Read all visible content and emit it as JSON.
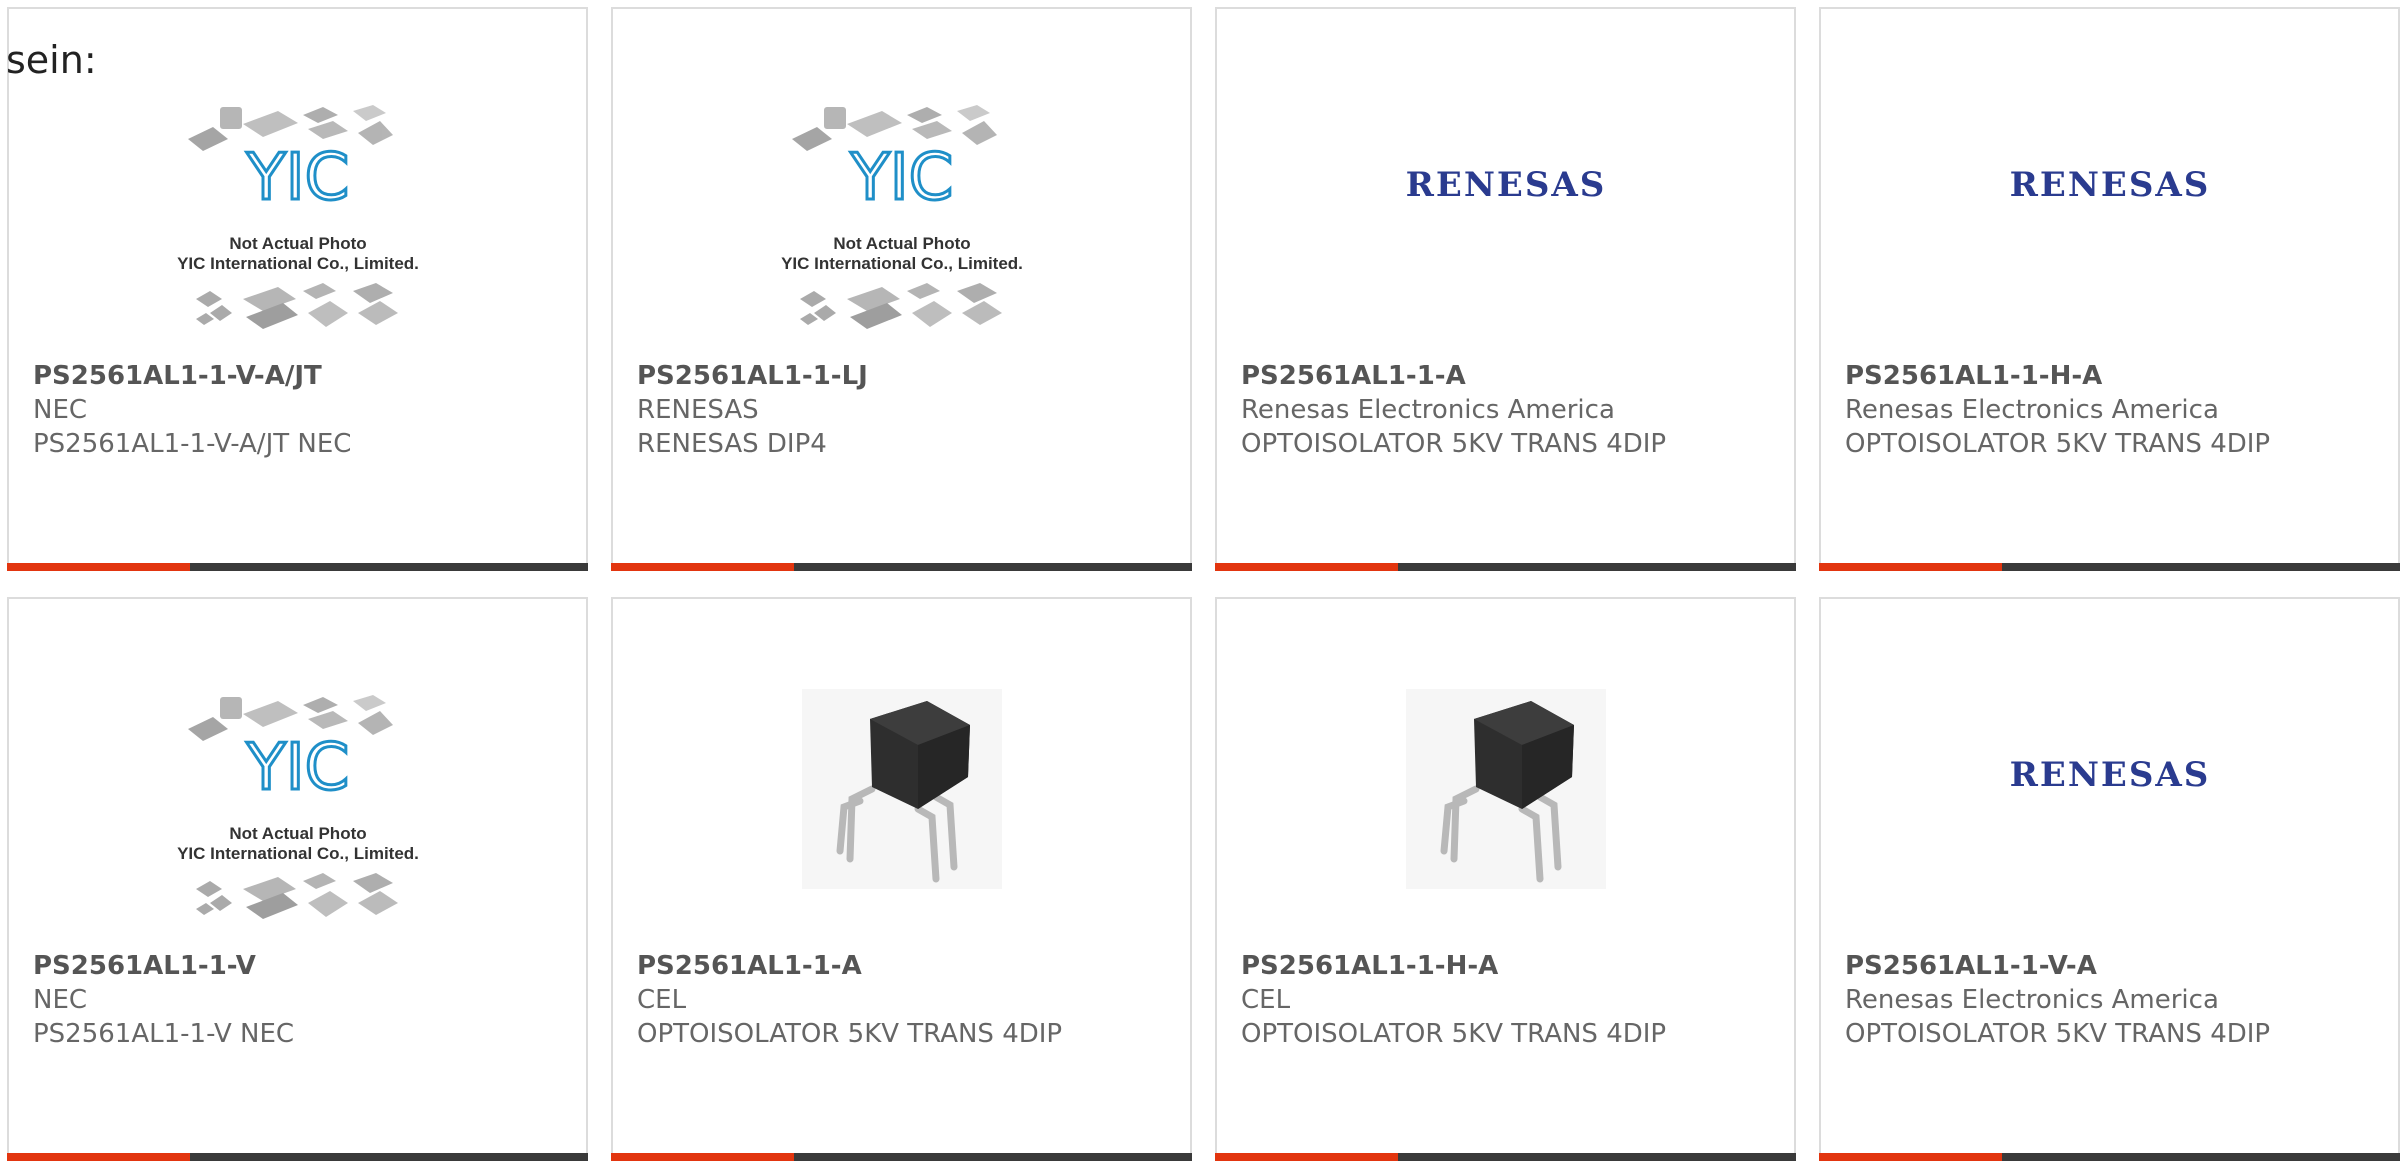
{
  "intro_text": "sein:",
  "placeholder_text": {
    "line1": "Not Actual Photo",
    "line2": "YIC International Co., Limited.",
    "logo": "YIC"
  },
  "renesas_logo_text": "RENESAS",
  "colors": {
    "accent": "#e2350f",
    "bar_dark": "#3a3a3a",
    "logo_blue": "#2a3b8f",
    "yic_blue": "#1f8fc8"
  },
  "products": [
    {
      "image": "placeholder",
      "part_number": "PS2561AL1-1-V-A/JT",
      "manufacturer": "NEC",
      "description": "PS2561AL1-1-V-A/JT NEC"
    },
    {
      "image": "placeholder",
      "part_number": "PS2561AL1-1-LJ",
      "manufacturer": "RENESAS",
      "description": "RENESAS DIP4"
    },
    {
      "image": "renesas-logo",
      "part_number": "PS2561AL1-1-A",
      "manufacturer": "Renesas Electronics America",
      "description": "OPTOISOLATOR 5KV TRANS 4DIP"
    },
    {
      "image": "renesas-logo",
      "part_number": "PS2561AL1-1-H-A",
      "manufacturer": "Renesas Electronics America",
      "description": "OPTOISOLATOR 5KV TRANS 4DIP"
    },
    {
      "image": "placeholder",
      "part_number": "PS2561AL1-1-V",
      "manufacturer": "NEC",
      "description": "PS2561AL1-1-V NEC"
    },
    {
      "image": "dip4-photo",
      "part_number": "PS2561AL1-1-A",
      "manufacturer": "CEL",
      "description": "OPTOISOLATOR 5KV TRANS 4DIP"
    },
    {
      "image": "dip4-photo",
      "part_number": "PS2561AL1-1-H-A",
      "manufacturer": "CEL",
      "description": "OPTOISOLATOR 5KV TRANS 4DIP"
    },
    {
      "image": "renesas-logo",
      "part_number": "PS2561AL1-1-V-A",
      "manufacturer": "Renesas Electronics America",
      "description": "OPTOISOLATOR 5KV TRANS 4DIP"
    }
  ]
}
